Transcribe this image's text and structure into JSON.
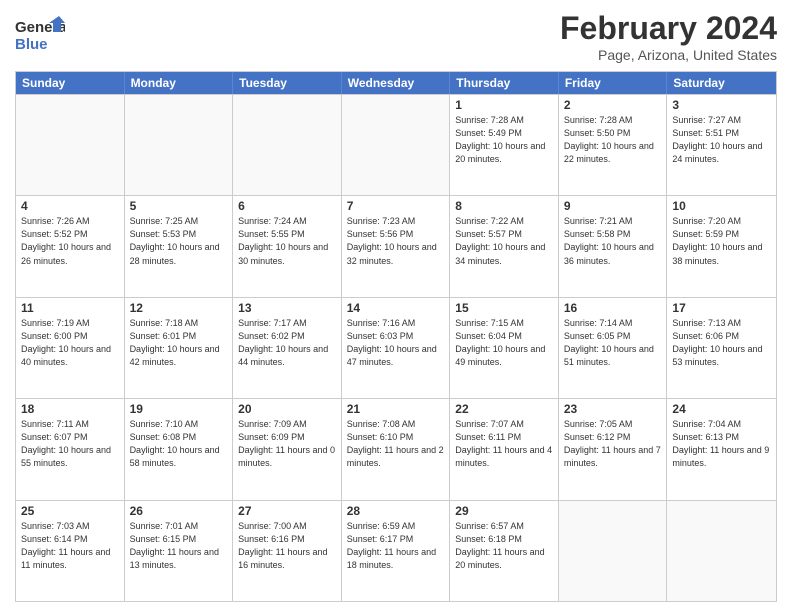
{
  "logo": {
    "line1": "General",
    "line2": "Blue"
  },
  "title": "February 2024",
  "location": "Page, Arizona, United States",
  "header": {
    "days": [
      "Sunday",
      "Monday",
      "Tuesday",
      "Wednesday",
      "Thursday",
      "Friday",
      "Saturday"
    ]
  },
  "weeks": [
    [
      {
        "day": "",
        "sunrise": "",
        "sunset": "",
        "daylight": ""
      },
      {
        "day": "",
        "sunrise": "",
        "sunset": "",
        "daylight": ""
      },
      {
        "day": "",
        "sunrise": "",
        "sunset": "",
        "daylight": ""
      },
      {
        "day": "",
        "sunrise": "",
        "sunset": "",
        "daylight": ""
      },
      {
        "day": "1",
        "sunrise": "Sunrise: 7:28 AM",
        "sunset": "Sunset: 5:49 PM",
        "daylight": "Daylight: 10 hours and 20 minutes."
      },
      {
        "day": "2",
        "sunrise": "Sunrise: 7:28 AM",
        "sunset": "Sunset: 5:50 PM",
        "daylight": "Daylight: 10 hours and 22 minutes."
      },
      {
        "day": "3",
        "sunrise": "Sunrise: 7:27 AM",
        "sunset": "Sunset: 5:51 PM",
        "daylight": "Daylight: 10 hours and 24 minutes."
      }
    ],
    [
      {
        "day": "4",
        "sunrise": "Sunrise: 7:26 AM",
        "sunset": "Sunset: 5:52 PM",
        "daylight": "Daylight: 10 hours and 26 minutes."
      },
      {
        "day": "5",
        "sunrise": "Sunrise: 7:25 AM",
        "sunset": "Sunset: 5:53 PM",
        "daylight": "Daylight: 10 hours and 28 minutes."
      },
      {
        "day": "6",
        "sunrise": "Sunrise: 7:24 AM",
        "sunset": "Sunset: 5:55 PM",
        "daylight": "Daylight: 10 hours and 30 minutes."
      },
      {
        "day": "7",
        "sunrise": "Sunrise: 7:23 AM",
        "sunset": "Sunset: 5:56 PM",
        "daylight": "Daylight: 10 hours and 32 minutes."
      },
      {
        "day": "8",
        "sunrise": "Sunrise: 7:22 AM",
        "sunset": "Sunset: 5:57 PM",
        "daylight": "Daylight: 10 hours and 34 minutes."
      },
      {
        "day": "9",
        "sunrise": "Sunrise: 7:21 AM",
        "sunset": "Sunset: 5:58 PM",
        "daylight": "Daylight: 10 hours and 36 minutes."
      },
      {
        "day": "10",
        "sunrise": "Sunrise: 7:20 AM",
        "sunset": "Sunset: 5:59 PM",
        "daylight": "Daylight: 10 hours and 38 minutes."
      }
    ],
    [
      {
        "day": "11",
        "sunrise": "Sunrise: 7:19 AM",
        "sunset": "Sunset: 6:00 PM",
        "daylight": "Daylight: 10 hours and 40 minutes."
      },
      {
        "day": "12",
        "sunrise": "Sunrise: 7:18 AM",
        "sunset": "Sunset: 6:01 PM",
        "daylight": "Daylight: 10 hours and 42 minutes."
      },
      {
        "day": "13",
        "sunrise": "Sunrise: 7:17 AM",
        "sunset": "Sunset: 6:02 PM",
        "daylight": "Daylight: 10 hours and 44 minutes."
      },
      {
        "day": "14",
        "sunrise": "Sunrise: 7:16 AM",
        "sunset": "Sunset: 6:03 PM",
        "daylight": "Daylight: 10 hours and 47 minutes."
      },
      {
        "day": "15",
        "sunrise": "Sunrise: 7:15 AM",
        "sunset": "Sunset: 6:04 PM",
        "daylight": "Daylight: 10 hours and 49 minutes."
      },
      {
        "day": "16",
        "sunrise": "Sunrise: 7:14 AM",
        "sunset": "Sunset: 6:05 PM",
        "daylight": "Daylight: 10 hours and 51 minutes."
      },
      {
        "day": "17",
        "sunrise": "Sunrise: 7:13 AM",
        "sunset": "Sunset: 6:06 PM",
        "daylight": "Daylight: 10 hours and 53 minutes."
      }
    ],
    [
      {
        "day": "18",
        "sunrise": "Sunrise: 7:11 AM",
        "sunset": "Sunset: 6:07 PM",
        "daylight": "Daylight: 10 hours and 55 minutes."
      },
      {
        "day": "19",
        "sunrise": "Sunrise: 7:10 AM",
        "sunset": "Sunset: 6:08 PM",
        "daylight": "Daylight: 10 hours and 58 minutes."
      },
      {
        "day": "20",
        "sunrise": "Sunrise: 7:09 AM",
        "sunset": "Sunset: 6:09 PM",
        "daylight": "Daylight: 11 hours and 0 minutes."
      },
      {
        "day": "21",
        "sunrise": "Sunrise: 7:08 AM",
        "sunset": "Sunset: 6:10 PM",
        "daylight": "Daylight: 11 hours and 2 minutes."
      },
      {
        "day": "22",
        "sunrise": "Sunrise: 7:07 AM",
        "sunset": "Sunset: 6:11 PM",
        "daylight": "Daylight: 11 hours and 4 minutes."
      },
      {
        "day": "23",
        "sunrise": "Sunrise: 7:05 AM",
        "sunset": "Sunset: 6:12 PM",
        "daylight": "Daylight: 11 hours and 7 minutes."
      },
      {
        "day": "24",
        "sunrise": "Sunrise: 7:04 AM",
        "sunset": "Sunset: 6:13 PM",
        "daylight": "Daylight: 11 hours and 9 minutes."
      }
    ],
    [
      {
        "day": "25",
        "sunrise": "Sunrise: 7:03 AM",
        "sunset": "Sunset: 6:14 PM",
        "daylight": "Daylight: 11 hours and 11 minutes."
      },
      {
        "day": "26",
        "sunrise": "Sunrise: 7:01 AM",
        "sunset": "Sunset: 6:15 PM",
        "daylight": "Daylight: 11 hours and 13 minutes."
      },
      {
        "day": "27",
        "sunrise": "Sunrise: 7:00 AM",
        "sunset": "Sunset: 6:16 PM",
        "daylight": "Daylight: 11 hours and 16 minutes."
      },
      {
        "day": "28",
        "sunrise": "Sunrise: 6:59 AM",
        "sunset": "Sunset: 6:17 PM",
        "daylight": "Daylight: 11 hours and 18 minutes."
      },
      {
        "day": "29",
        "sunrise": "Sunrise: 6:57 AM",
        "sunset": "Sunset: 6:18 PM",
        "daylight": "Daylight: 11 hours and 20 minutes."
      },
      {
        "day": "",
        "sunrise": "",
        "sunset": "",
        "daylight": ""
      },
      {
        "day": "",
        "sunrise": "",
        "sunset": "",
        "daylight": ""
      }
    ]
  ]
}
